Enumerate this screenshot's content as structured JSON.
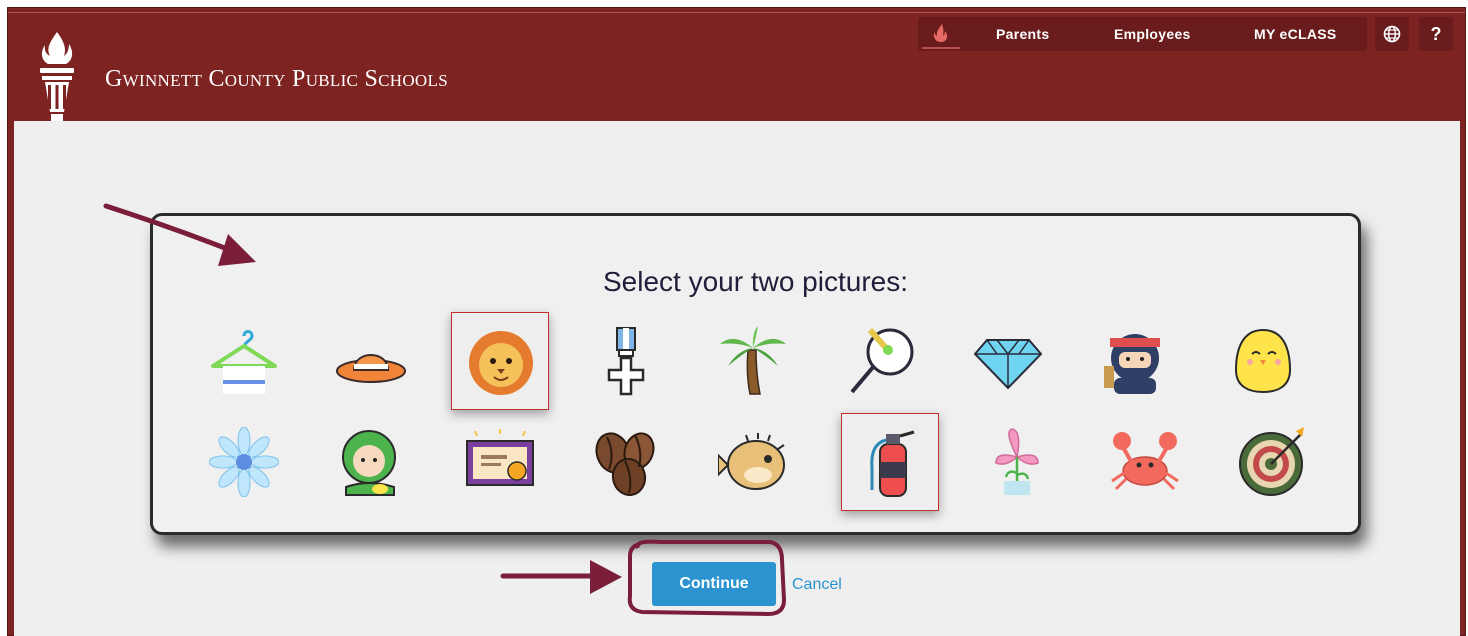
{
  "header": {
    "logo_text": "Gwinnett County Public Schools",
    "nav": {
      "items": [
        "Parents",
        "Employees",
        "MY eCLASS"
      ],
      "globe_icon": "globe-icon",
      "help_label": "?"
    }
  },
  "modal": {
    "title": "Select your two pictures:",
    "pictures": [
      {
        "name": "hanger",
        "selected": false
      },
      {
        "name": "sun-hat",
        "selected": false
      },
      {
        "name": "lion",
        "selected": true
      },
      {
        "name": "medal",
        "selected": false
      },
      {
        "name": "palm-tree",
        "selected": false
      },
      {
        "name": "badminton",
        "selected": false
      },
      {
        "name": "diamond",
        "selected": false
      },
      {
        "name": "ninja",
        "selected": false
      },
      {
        "name": "chick",
        "selected": false
      },
      {
        "name": "flower",
        "selected": false
      },
      {
        "name": "dino-kid",
        "selected": false
      },
      {
        "name": "certificate",
        "selected": false
      },
      {
        "name": "coffee-beans",
        "selected": false
      },
      {
        "name": "pufferfish",
        "selected": false
      },
      {
        "name": "fire-extinguisher",
        "selected": true
      },
      {
        "name": "orchid",
        "selected": false
      },
      {
        "name": "crab",
        "selected": false
      },
      {
        "name": "dartboard",
        "selected": false
      }
    ]
  },
  "actions": {
    "continue_label": "Continue",
    "cancel_label": "Cancel"
  },
  "colors": {
    "header_bg": "#7d2322",
    "button_blue": "#2b93cf",
    "selected_border": "#c0302e",
    "annotation": "#7a1e3a"
  }
}
